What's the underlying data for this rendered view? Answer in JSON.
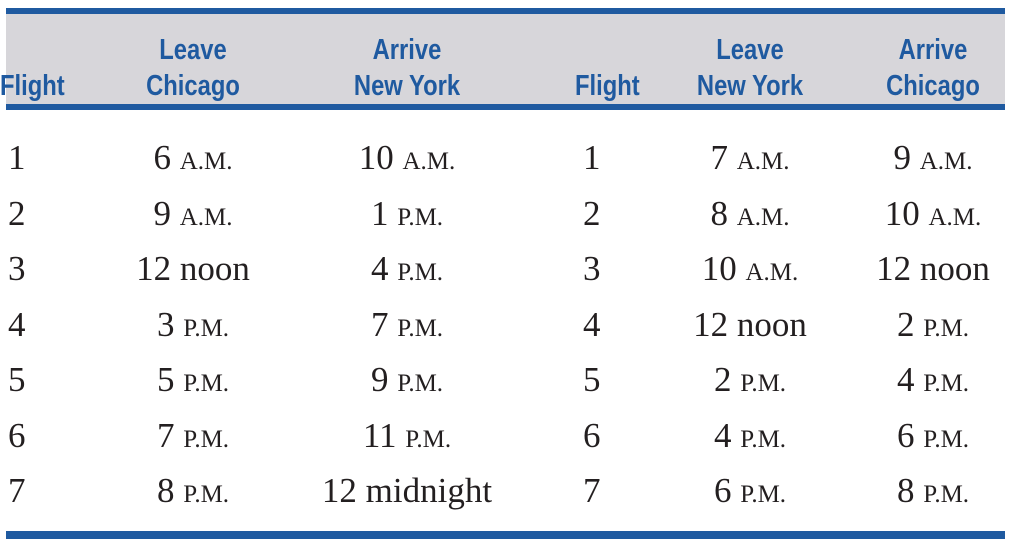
{
  "headers": [
    {
      "lines": [
        "Flight"
      ]
    },
    {
      "lines": [
        "Leave",
        "Chicago"
      ]
    },
    {
      "lines": [
        "Arrive",
        "New York"
      ]
    },
    {
      "lines": [
        "Flight"
      ]
    },
    {
      "lines": [
        "Leave",
        "New York"
      ]
    },
    {
      "lines": [
        "Arrive",
        "Chicago"
      ]
    }
  ],
  "rows": [
    [
      {
        "num": "1"
      },
      {
        "num": "6",
        "unit": "A.M."
      },
      {
        "num": "10",
        "unit": "A.M."
      },
      {
        "num": "1"
      },
      {
        "num": "7",
        "unit": "A.M."
      },
      {
        "num": "9",
        "unit": "A.M."
      }
    ],
    [
      {
        "num": "2"
      },
      {
        "num": "9",
        "unit": "A.M."
      },
      {
        "num": "1",
        "unit": "P.M."
      },
      {
        "num": "2"
      },
      {
        "num": "8",
        "unit": "A.M."
      },
      {
        "num": "10",
        "unit": "A.M."
      }
    ],
    [
      {
        "num": "3"
      },
      {
        "num": "12",
        "unit": "noon"
      },
      {
        "num": "4",
        "unit": "P.M."
      },
      {
        "num": "3"
      },
      {
        "num": "10",
        "unit": "A.M."
      },
      {
        "num": "12",
        "unit": "noon"
      }
    ],
    [
      {
        "num": "4"
      },
      {
        "num": "3",
        "unit": "P.M."
      },
      {
        "num": "7",
        "unit": "P.M."
      },
      {
        "num": "4"
      },
      {
        "num": "12",
        "unit": "noon"
      },
      {
        "num": "2",
        "unit": "P.M."
      }
    ],
    [
      {
        "num": "5"
      },
      {
        "num": "5",
        "unit": "P.M."
      },
      {
        "num": "9",
        "unit": "P.M."
      },
      {
        "num": "5"
      },
      {
        "num": "2",
        "unit": "P.M."
      },
      {
        "num": "4",
        "unit": "P.M."
      }
    ],
    [
      {
        "num": "6"
      },
      {
        "num": "7",
        "unit": "P.M."
      },
      {
        "num": "11",
        "unit": "P.M."
      },
      {
        "num": "6"
      },
      {
        "num": "4",
        "unit": "P.M."
      },
      {
        "num": "6",
        "unit": "P.M."
      }
    ],
    [
      {
        "num": "7"
      },
      {
        "num": "8",
        "unit": "P.M."
      },
      {
        "num": "12",
        "unit": "midnight"
      },
      {
        "num": "7"
      },
      {
        "num": "6",
        "unit": "P.M."
      },
      {
        "num": "8",
        "unit": "P.M."
      }
    ]
  ],
  "colors": {
    "accent": "#1f5aa0",
    "header_bg": "#d7d6da",
    "text": "#231f20"
  }
}
